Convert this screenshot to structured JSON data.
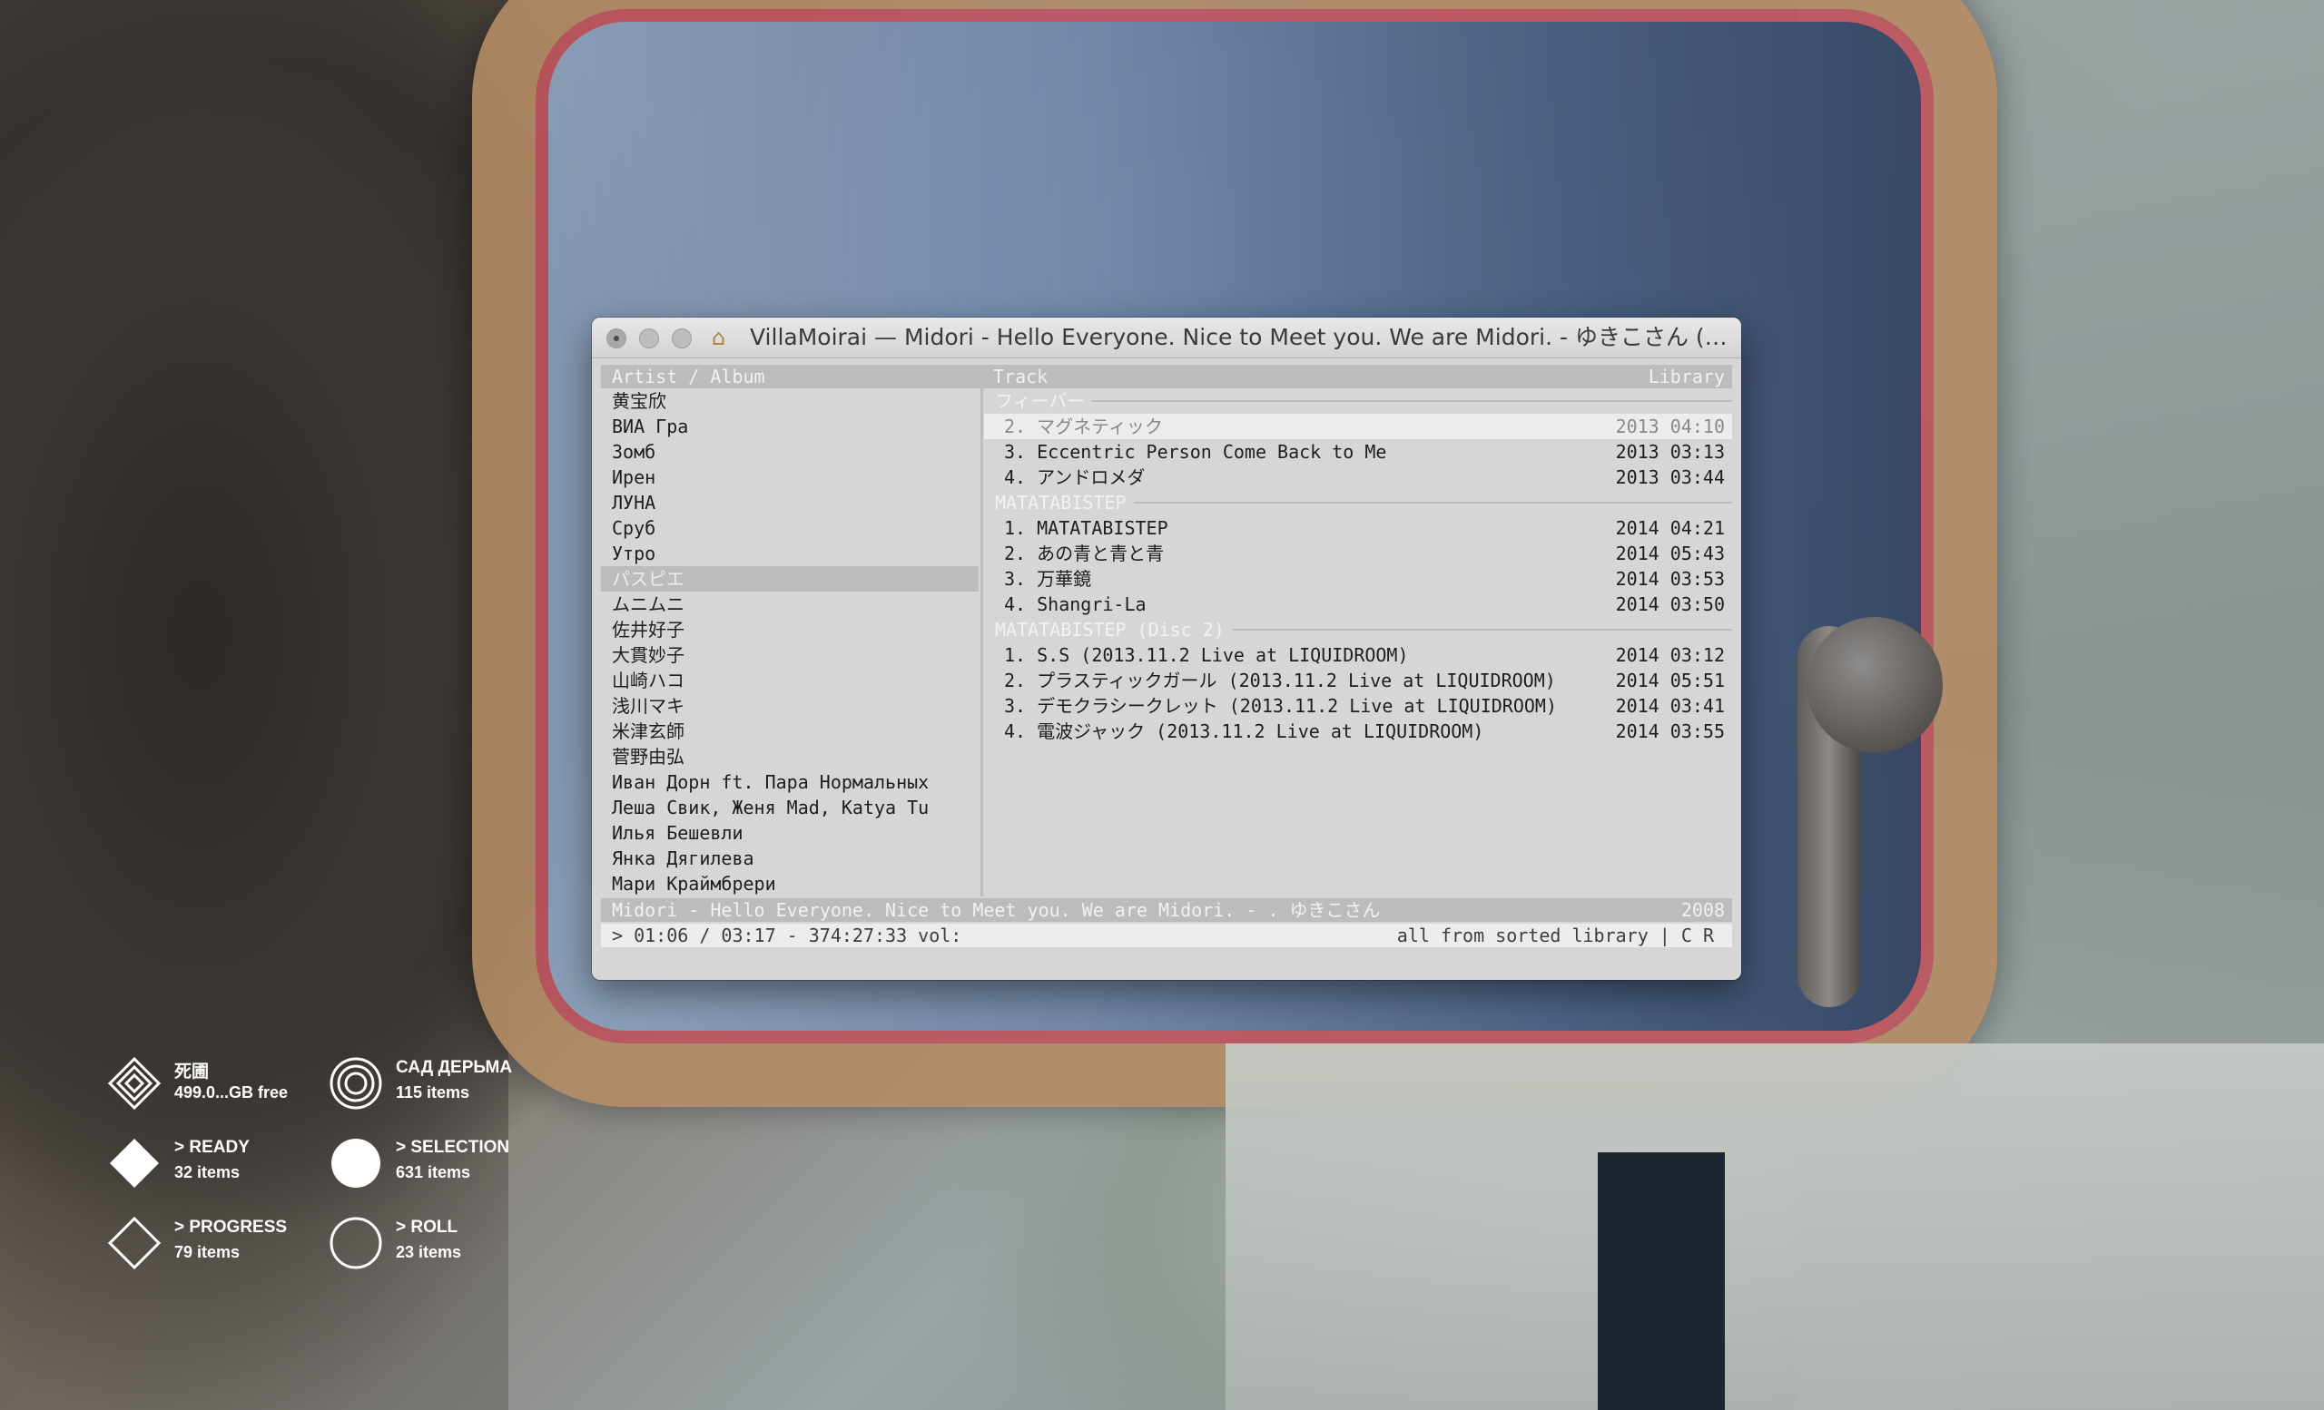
{
  "window": {
    "title": "VillaMoirai — Midori - Hello Everyone. Nice to Meet you. We are Midori. - ゆきこさん (2008)...",
    "title_icon": "home-folder-icon"
  },
  "columns": {
    "artist": "Artist / Album",
    "track": "Track",
    "library": "Library"
  },
  "artists": [
    "黄宝欣",
    "ВИА Гра",
    "Зомб",
    "Ирен",
    "ЛУНА",
    "Сруб",
    "Утро",
    "パスピエ",
    "ムニムニ",
    "佐井好子",
    "大貫妙子",
    "山崎ハコ",
    "浅川マキ",
    "米津玄師",
    "菅野由弘",
    "Иван Дорн ft. Пара Нормальных",
    "Леша Свик, Женя Mad, Katya Tu",
    "Илья Бешевли",
    "Янка Дягилева",
    "Мари Краймбрери"
  ],
  "selected_artist": "パスピエ",
  "sections": [
    {
      "title": "フィーバー",
      "tracks": [
        {
          "name": "2. マグネティック",
          "year": "2013",
          "time": "04:10",
          "selected": true
        },
        {
          "name": "3. Eccentric Person Come Back to Me",
          "year": "2013",
          "time": "03:13"
        },
        {
          "name": "4. アンドロメダ",
          "year": "2013",
          "time": "03:44"
        }
      ]
    },
    {
      "title": "MATATABISTEP",
      "tracks": [
        {
          "name": "1. MATATABISTEP",
          "year": "2014",
          "time": "04:21"
        },
        {
          "name": "2. あの青と青と青",
          "year": "2014",
          "time": "05:43"
        },
        {
          "name": "3. 万華鏡",
          "year": "2014",
          "time": "03:53"
        },
        {
          "name": "4. Shangri-La",
          "year": "2014",
          "time": "03:50"
        }
      ]
    },
    {
      "title": "MATATABISTEP (Disc 2)",
      "tracks": [
        {
          "name": "1. S.S (2013.11.2 Live at LIQUIDROOM)",
          "year": "2014",
          "time": "03:12"
        },
        {
          "name": "2. プラスティックガール (2013.11.2 Live at LIQUIDROOM)",
          "year": "2014",
          "time": "05:51"
        },
        {
          "name": "3. デモクラシークレット (2013.11.2 Live at LIQUIDROOM)",
          "year": "2014",
          "time": "03:41"
        },
        {
          "name": "4. 電波ジャック (2013.11.2 Live at LIQUIDROOM)",
          "year": "2014",
          "time": "03:55"
        }
      ]
    }
  ],
  "status_bar": {
    "now_playing": "Midori - Hello Everyone. Nice to Meet you. We are Midori. -  . ゆきこさん",
    "year": "2008"
  },
  "command_line": {
    "position": "> 01:06 / 03:17 - 374:27:33 vol:",
    "mode": "all from sorted library | C R"
  },
  "widgets": [
    {
      "label": "死圃",
      "sub": "499.0...GB free",
      "icon": "concentric-diamond-icon"
    },
    {
      "label": "САД ДЕРЬМА",
      "sub": "115 items",
      "icon": "concentric-circle-icon"
    },
    {
      "label": "> READY",
      "sub": "32 items",
      "icon": "filled-diamond-icon"
    },
    {
      "label": "> SELECTION",
      "sub": "631 items",
      "icon": "filled-circle-icon"
    },
    {
      "label": "> PROGRESS",
      "sub": "79 items",
      "icon": "outline-diamond-icon"
    },
    {
      "label": "> ROLL",
      "sub": "23 items",
      "icon": "outline-circle-icon"
    }
  ]
}
